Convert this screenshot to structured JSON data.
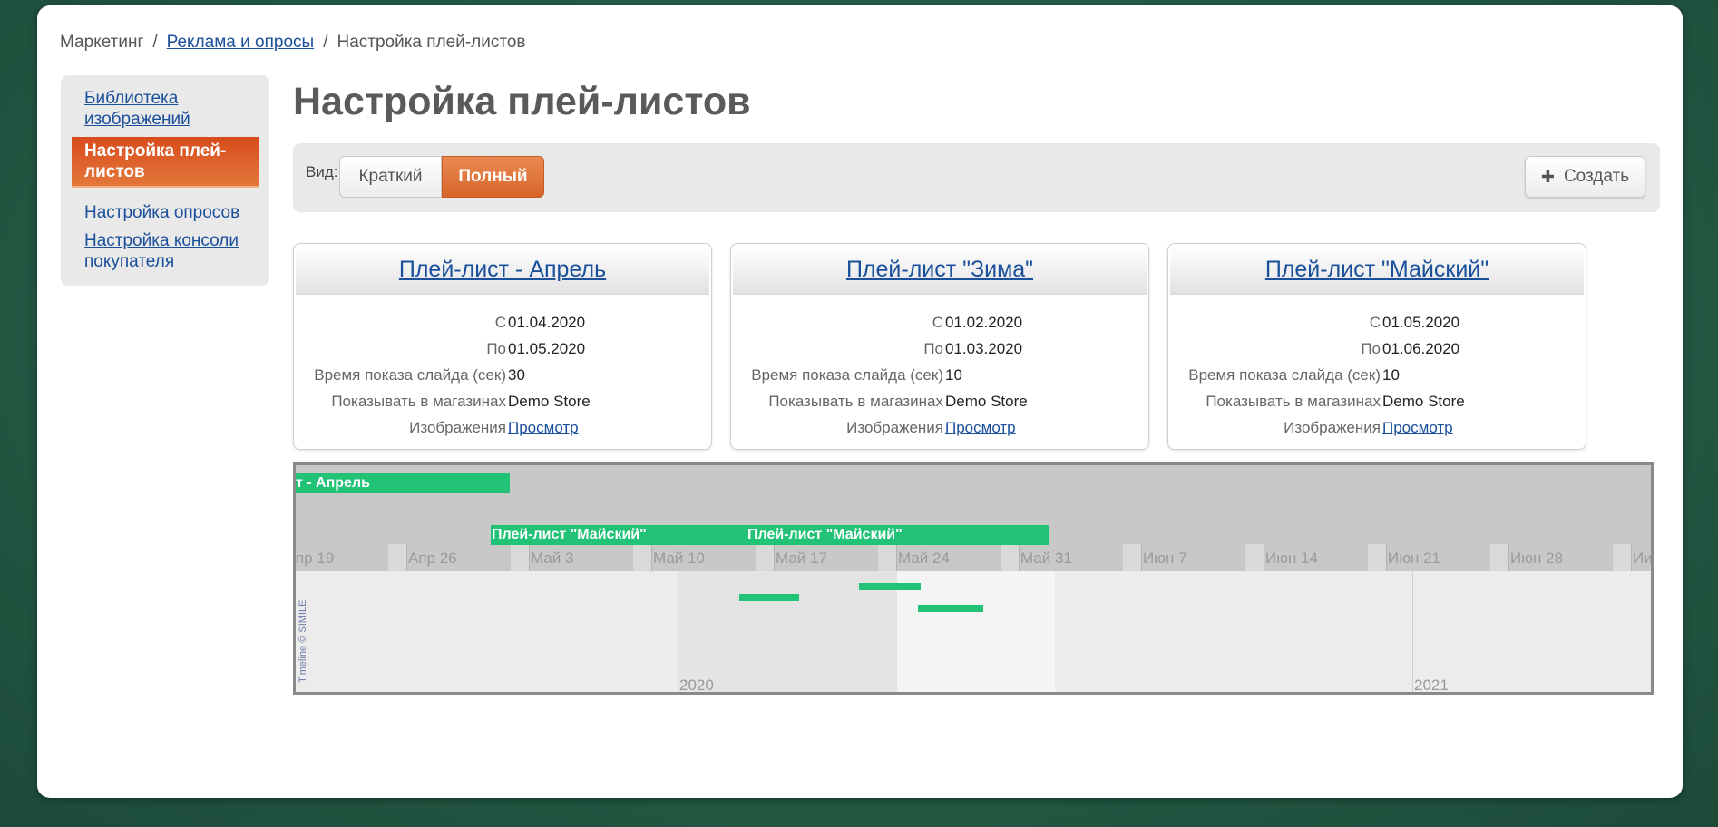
{
  "breadcrumb": {
    "root": "Маркетинг",
    "link": "Реклама и опросы",
    "current": "Настройка плей-листов",
    "separator": "/"
  },
  "sidebar": {
    "items": [
      {
        "label": "Библиотека изображений"
      },
      {
        "label": "Настройка плей-листов"
      },
      {
        "label": "Настройка опросов"
      },
      {
        "label": "Настройка консоли покупателя"
      }
    ]
  },
  "page_title": "Настройка плей-листов",
  "toolbar": {
    "view_label": "Вид:",
    "view_short": "Краткий",
    "view_full": "Полный",
    "create_icon": "plus-icon",
    "create_label": "Создать"
  },
  "card_labels": {
    "from": "С",
    "to": "По",
    "slide_time": "Время показа слайда (сек)",
    "show_in_stores": "Показывать в магазинах",
    "images": "Изображения"
  },
  "cards": [
    {
      "title": "Плей-лист - Апрель",
      "from": "01.04.2020",
      "to": "01.05.2020",
      "slide_time": "30",
      "stores": "Demo Store",
      "images_link": "Просмотр"
    },
    {
      "title": "Плей-лист \"Зима\"",
      "from": "01.02.2020",
      "to": "01.03.2020",
      "slide_time": "10",
      "stores": "Demo Store",
      "images_link": "Просмотр"
    },
    {
      "title": "Плей-лист \"Майский\"",
      "from": "01.05.2020",
      "to": "01.06.2020",
      "slide_time": "10",
      "stores": "Demo Store",
      "images_link": "Просмотр"
    }
  ],
  "timeline": {
    "event_labels": [
      "т - Апрель",
      "Плей-лист \"Майский\"",
      "Плей-лист \"Майский\""
    ],
    "ticks": [
      "пр 19",
      "Апр 26",
      "Май 3",
      "Май 10",
      "Май 17",
      "Май 24",
      "Май 31",
      "Июн 7",
      "Июн 14",
      "Июн 21",
      "Июн 28",
      "Ии"
    ],
    "years": [
      "2020",
      "2021"
    ],
    "copyright": "Timeline © SIMILE",
    "accent_color": "#22c277"
  }
}
